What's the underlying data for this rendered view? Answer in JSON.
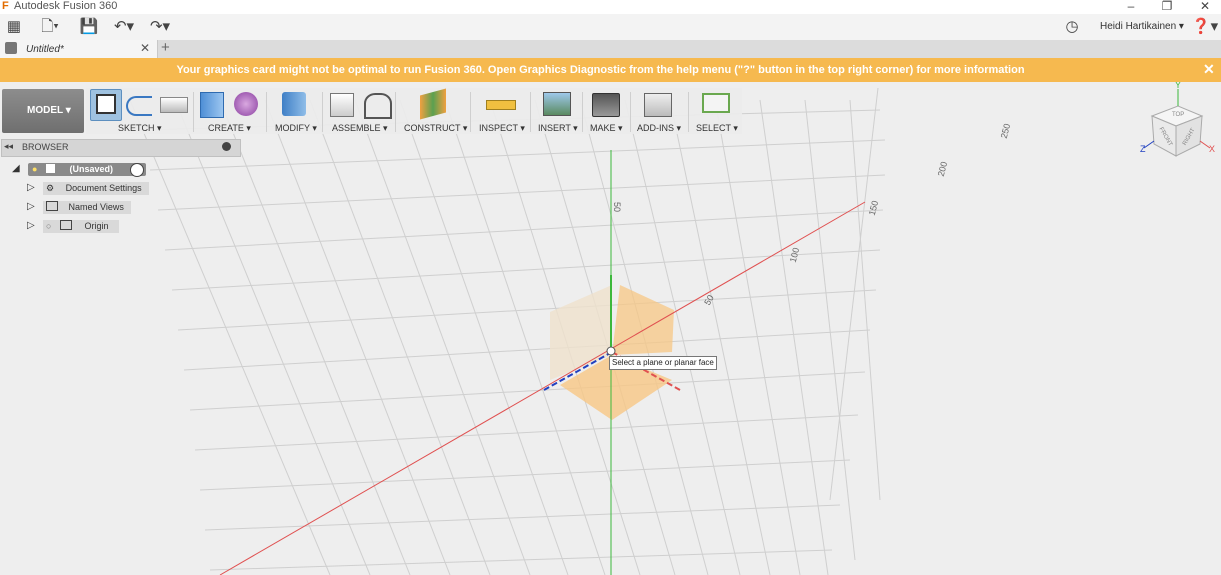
{
  "window": {
    "title": "Autodesk Fusion 360",
    "user": "Heidi Hartikainen ▾"
  },
  "tabs": [
    {
      "label": "Untitled*"
    }
  ],
  "banner": {
    "message": "Your graphics card might not be optimal to run Fusion 360. Open Graphics Diagnostic from the help menu (\"?\" button in the top right corner) for more information"
  },
  "workspace": {
    "label": "MODEL ▾"
  },
  "ribbon": {
    "groups": [
      {
        "label": "SKETCH ▾"
      },
      {
        "label": "CREATE ▾"
      },
      {
        "label": "MODIFY ▾"
      },
      {
        "label": "ASSEMBLE ▾"
      },
      {
        "label": "CONSTRUCT ▾"
      },
      {
        "label": "INSPECT ▾"
      },
      {
        "label": "INSERT ▾"
      },
      {
        "label": "MAKE ▾"
      },
      {
        "label": "ADD-INS ▾"
      },
      {
        "label": "SELECT ▾"
      }
    ]
  },
  "browser": {
    "title": "BROWSER",
    "root": "(Unsaved)",
    "items": [
      {
        "label": "Document Settings"
      },
      {
        "label": "Named Views"
      },
      {
        "label": "Origin"
      }
    ]
  },
  "viewport": {
    "tooltip": "Select a plane or planar face",
    "viewcube": {
      "top": "TOP",
      "front": "FRONT",
      "right": "RIGHT",
      "x": "X",
      "y": "Y",
      "z": "Z"
    },
    "axis_labels": [
      "50",
      "50",
      "50",
      "100",
      "150",
      "250",
      "200"
    ]
  },
  "colors": {
    "banner": "#f6b94f",
    "x_axis": "#e05050",
    "y_axis": "#3cb83c",
    "z_axis": "#2040c0",
    "plane": "#f7c784"
  }
}
